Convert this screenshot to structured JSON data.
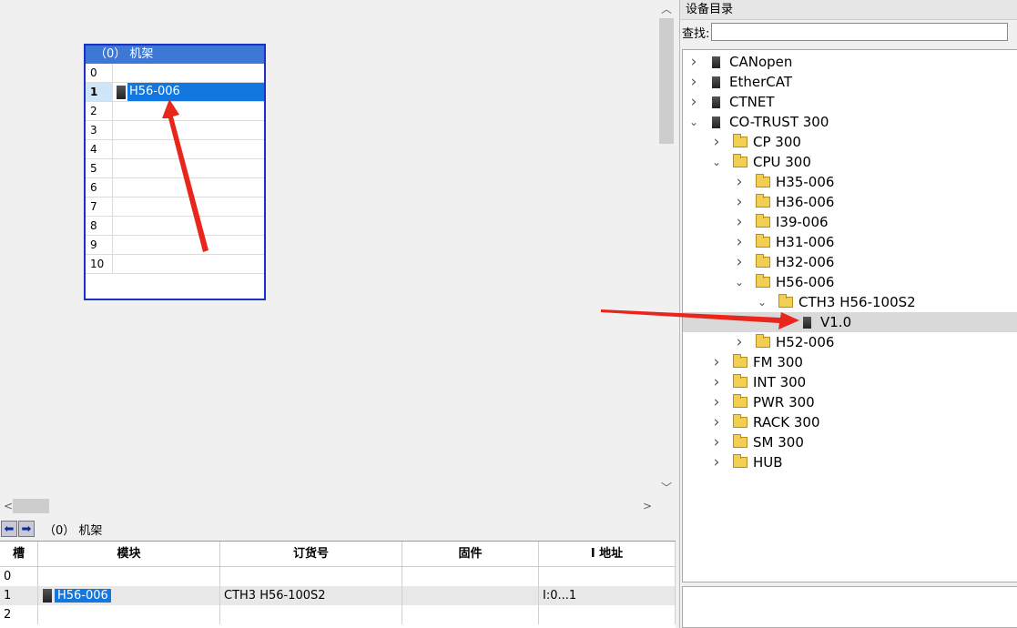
{
  "rack": {
    "title": "（0） 机架",
    "slots": [
      "0",
      "1",
      "2",
      "3",
      "4",
      "5",
      "6",
      "7",
      "8",
      "9",
      "10"
    ],
    "module_slot1": "H56-006"
  },
  "bottom": {
    "title": "（0） 机架",
    "headers": [
      "槽",
      "模块",
      "订货号",
      "固件",
      "I 地址"
    ],
    "rows": [
      {
        "slot": "0",
        "module": "",
        "order": "",
        "firmware": "",
        "iaddr": ""
      },
      {
        "slot": "1",
        "module": "H56-006",
        "order": "CTH3 H56-100S2",
        "firmware": "",
        "iaddr": "I:0...1"
      },
      {
        "slot": "2",
        "module": "",
        "order": "",
        "firmware": "",
        "iaddr": ""
      }
    ]
  },
  "catalog": {
    "title": "设备目录",
    "search_label": "查找:",
    "search_value": "",
    "tree": [
      {
        "label": "CANopen",
        "icon": "device-icon",
        "expanded": false
      },
      {
        "label": "EtherCAT",
        "icon": "device-icon",
        "expanded": false
      },
      {
        "label": "CTNET",
        "icon": "device-icon",
        "expanded": false
      },
      {
        "label": "CO-TRUST 300",
        "icon": "device-icon",
        "expanded": true
      },
      {
        "label": "CP 300",
        "icon": "folder-icon",
        "expanded": false
      },
      {
        "label": "CPU 300",
        "icon": "folder-icon",
        "expanded": true
      },
      {
        "label": "H35-006",
        "icon": "folder-icon",
        "expanded": false
      },
      {
        "label": "H36-006",
        "icon": "folder-icon",
        "expanded": false
      },
      {
        "label": "I39-006",
        "icon": "folder-icon",
        "expanded": false
      },
      {
        "label": "H31-006",
        "icon": "folder-icon",
        "expanded": false
      },
      {
        "label": "H32-006",
        "icon": "folder-icon",
        "expanded": false
      },
      {
        "label": "H56-006",
        "icon": "folder-icon",
        "expanded": true
      },
      {
        "label": "CTH3 H56-100S2",
        "icon": "folder-icon",
        "expanded": true
      },
      {
        "label": "V1.0",
        "icon": "device-icon",
        "selected": true
      },
      {
        "label": "H52-006",
        "icon": "folder-icon",
        "expanded": false
      },
      {
        "label": "FM 300",
        "icon": "folder-icon",
        "expanded": false
      },
      {
        "label": "INT 300",
        "icon": "folder-icon",
        "expanded": false
      },
      {
        "label": "PWR 300",
        "icon": "folder-icon",
        "expanded": false
      },
      {
        "label": "RACK 300",
        "icon": "folder-icon",
        "expanded": false
      },
      {
        "label": "SM 300",
        "icon": "folder-icon",
        "expanded": false
      },
      {
        "label": "HUB",
        "icon": "folder-icon",
        "expanded": false
      }
    ]
  },
  "colors": {
    "selection": "#1277df",
    "rack_title": "#3d78d6",
    "rack_border": "#1c2fc7",
    "annotation_arrow": "#e8261c"
  }
}
